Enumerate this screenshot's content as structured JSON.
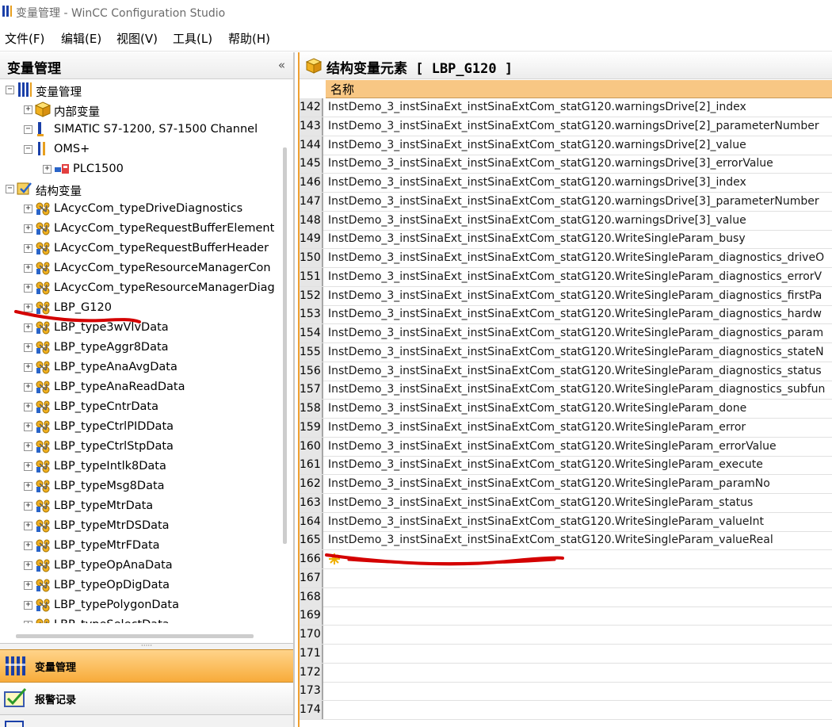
{
  "window": {
    "title": "变量管理 - WinCC Configuration Studio"
  },
  "menu": [
    "文件(F)",
    "编辑(E)",
    "视图(V)",
    "工具(L)",
    "帮助(H)"
  ],
  "left_panel": {
    "title": "变量管理",
    "collapse_glyph": "«",
    "tree": [
      {
        "label": "变量管理",
        "level": 0,
        "expander": "−",
        "icon": "tag-management-icon"
      },
      {
        "label": "内部变量",
        "level": 1,
        "expander": "+",
        "icon": "internal-tags-icon"
      },
      {
        "label": "SIMATIC S7-1200, S7-1500 Channel",
        "level": 1,
        "expander": "−",
        "icon": "channel-icon"
      },
      {
        "label": "OMS+",
        "level": 2,
        "expander": "−",
        "icon": "connection-icon"
      },
      {
        "label": "PLC1500",
        "level": 3,
        "expander": "+",
        "icon": "plc-icon"
      },
      {
        "label": "结构变量",
        "level": 0,
        "expander": "−",
        "icon": "structure-tags-icon"
      },
      {
        "label": "LAcycCom_typeDriveDiagnostics",
        "level": 1,
        "expander": "+",
        "icon": "struct-type-icon"
      },
      {
        "label": "LAcycCom_typeRequestBufferElement",
        "level": 1,
        "expander": "+",
        "icon": "struct-type-icon"
      },
      {
        "label": "LAcycCom_typeRequestBufferHeader",
        "level": 1,
        "expander": "+",
        "icon": "struct-type-icon"
      },
      {
        "label": "LAcycCom_typeResourceManagerCon",
        "level": 1,
        "expander": "+",
        "icon": "struct-type-icon"
      },
      {
        "label": "LAcycCom_typeResourceManagerDiag",
        "level": 1,
        "expander": "+",
        "icon": "struct-type-icon"
      },
      {
        "label": "LBP_G120",
        "level": 1,
        "expander": "+",
        "icon": "struct-type-icon"
      },
      {
        "label": "LBP_type3wVlvData",
        "level": 1,
        "expander": "+",
        "icon": "struct-type-icon"
      },
      {
        "label": "LBP_typeAggr8Data",
        "level": 1,
        "expander": "+",
        "icon": "struct-type-icon"
      },
      {
        "label": "LBP_typeAnaAvgData",
        "level": 1,
        "expander": "+",
        "icon": "struct-type-icon"
      },
      {
        "label": "LBP_typeAnaReadData",
        "level": 1,
        "expander": "+",
        "icon": "struct-type-icon"
      },
      {
        "label": "LBP_typeCntrData",
        "level": 1,
        "expander": "+",
        "icon": "struct-type-icon"
      },
      {
        "label": "LBP_typeCtrlPIDData",
        "level": 1,
        "expander": "+",
        "icon": "struct-type-icon"
      },
      {
        "label": "LBP_typeCtrlStpData",
        "level": 1,
        "expander": "+",
        "icon": "struct-type-icon"
      },
      {
        "label": "LBP_typeIntlk8Data",
        "level": 1,
        "expander": "+",
        "icon": "struct-type-icon"
      },
      {
        "label": "LBP_typeMsg8Data",
        "level": 1,
        "expander": "+",
        "icon": "struct-type-icon"
      },
      {
        "label": "LBP_typeMtrData",
        "level": 1,
        "expander": "+",
        "icon": "struct-type-icon"
      },
      {
        "label": "LBP_typeMtrDSData",
        "level": 1,
        "expander": "+",
        "icon": "struct-type-icon"
      },
      {
        "label": "LBP_typeMtrFData",
        "level": 1,
        "expander": "+",
        "icon": "struct-type-icon"
      },
      {
        "label": "LBP_typeOpAnaData",
        "level": 1,
        "expander": "+",
        "icon": "struct-type-icon"
      },
      {
        "label": "LBP_typeOpDigData",
        "level": 1,
        "expander": "+",
        "icon": "struct-type-icon"
      },
      {
        "label": "LBP_typePolygonData",
        "level": 1,
        "expander": "+",
        "icon": "struct-type-icon"
      },
      {
        "label": "LBP_typeSelectData",
        "level": 1,
        "expander": "+",
        "icon": "struct-type-icon"
      }
    ],
    "nav": [
      {
        "label": "变量管理",
        "icon": "tag-management-icon",
        "active": true
      },
      {
        "label": "报警记录",
        "icon": "alarm-logging-icon",
        "active": false
      }
    ]
  },
  "right_panel": {
    "title": "结构变量元素 [ LBP_G120 ]",
    "column_header": "名称",
    "rows": [
      {
        "num": "142",
        "name": "InstDemo_3_instSinaExt_instSinaExtCom_statG120.warningsDrive[2]_index"
      },
      {
        "num": "143",
        "name": "InstDemo_3_instSinaExt_instSinaExtCom_statG120.warningsDrive[2]_parameterNumber"
      },
      {
        "num": "144",
        "name": "InstDemo_3_instSinaExt_instSinaExtCom_statG120.warningsDrive[2]_value"
      },
      {
        "num": "145",
        "name": "InstDemo_3_instSinaExt_instSinaExtCom_statG120.warningsDrive[3]_errorValue"
      },
      {
        "num": "146",
        "name": "InstDemo_3_instSinaExt_instSinaExtCom_statG120.warningsDrive[3]_index"
      },
      {
        "num": "147",
        "name": "InstDemo_3_instSinaExt_instSinaExtCom_statG120.warningsDrive[3]_parameterNumber"
      },
      {
        "num": "148",
        "name": "InstDemo_3_instSinaExt_instSinaExtCom_statG120.warningsDrive[3]_value"
      },
      {
        "num": "149",
        "name": "InstDemo_3_instSinaExt_instSinaExtCom_statG120.WriteSingleParam_busy"
      },
      {
        "num": "150",
        "name": "InstDemo_3_instSinaExt_instSinaExtCom_statG120.WriteSingleParam_diagnostics_driveO"
      },
      {
        "num": "151",
        "name": "InstDemo_3_instSinaExt_instSinaExtCom_statG120.WriteSingleParam_diagnostics_errorV"
      },
      {
        "num": "152",
        "name": "InstDemo_3_instSinaExt_instSinaExtCom_statG120.WriteSingleParam_diagnostics_firstPa"
      },
      {
        "num": "153",
        "name": "InstDemo_3_instSinaExt_instSinaExtCom_statG120.WriteSingleParam_diagnostics_hardw"
      },
      {
        "num": "154",
        "name": "InstDemo_3_instSinaExt_instSinaExtCom_statG120.WriteSingleParam_diagnostics_param"
      },
      {
        "num": "155",
        "name": "InstDemo_3_instSinaExt_instSinaExtCom_statG120.WriteSingleParam_diagnostics_stateN"
      },
      {
        "num": "156",
        "name": "InstDemo_3_instSinaExt_instSinaExtCom_statG120.WriteSingleParam_diagnostics_status"
      },
      {
        "num": "157",
        "name": "InstDemo_3_instSinaExt_instSinaExtCom_statG120.WriteSingleParam_diagnostics_subfun"
      },
      {
        "num": "158",
        "name": "InstDemo_3_instSinaExt_instSinaExtCom_statG120.WriteSingleParam_done"
      },
      {
        "num": "159",
        "name": "InstDemo_3_instSinaExt_instSinaExtCom_statG120.WriteSingleParam_error"
      },
      {
        "num": "160",
        "name": "InstDemo_3_instSinaExt_instSinaExtCom_statG120.WriteSingleParam_errorValue"
      },
      {
        "num": "161",
        "name": "InstDemo_3_instSinaExt_instSinaExtCom_statG120.WriteSingleParam_execute"
      },
      {
        "num": "162",
        "name": "InstDemo_3_instSinaExt_instSinaExtCom_statG120.WriteSingleParam_paramNo"
      },
      {
        "num": "163",
        "name": "InstDemo_3_instSinaExt_instSinaExtCom_statG120.WriteSingleParam_status"
      },
      {
        "num": "164",
        "name": "InstDemo_3_instSinaExt_instSinaExtCom_statG120.WriteSingleParam_valueInt"
      },
      {
        "num": "165",
        "name": "InstDemo_3_instSinaExt_instSinaExtCom_statG120.WriteSingleParam_valueReal"
      },
      {
        "num": "166",
        "name": "",
        "new_row": true,
        "icon": "new-row-star-icon"
      },
      {
        "num": "167",
        "name": ""
      },
      {
        "num": "168",
        "name": ""
      },
      {
        "num": "169",
        "name": ""
      },
      {
        "num": "170",
        "name": ""
      },
      {
        "num": "171",
        "name": ""
      },
      {
        "num": "172",
        "name": ""
      },
      {
        "num": "173",
        "name": ""
      },
      {
        "num": "174",
        "name": ""
      }
    ]
  },
  "colors": {
    "accent_orange": "#f8ab3a",
    "column_header": "#f8c784",
    "annotation_red": "#d40000"
  }
}
